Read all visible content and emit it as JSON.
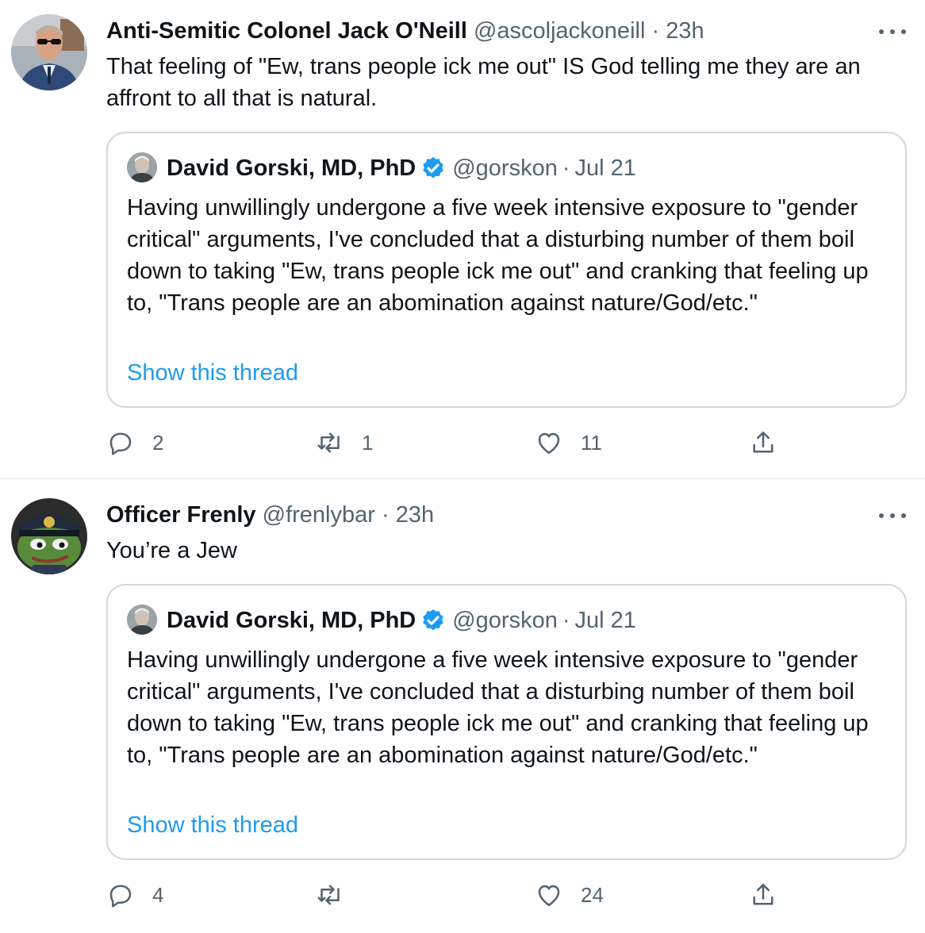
{
  "tweets": [
    {
      "display_name": "Anti-Semitic Colonel Jack O'Neill",
      "handle": "@ascoljackoneill",
      "separator": "·",
      "time": "23h",
      "text": "That feeling of \"Ew, trans people ick me out\" IS God telling me they are an affront to all that is natural.",
      "avatar_icon": "uniformed-man-sunglasses-avatar",
      "quote": {
        "display_name": "David Gorski, MD, PhD",
        "handle": "@gorskon",
        "separator": "·",
        "date": "Jul 21",
        "verified": true,
        "text": "Having unwillingly undergone a five week intensive exposure to \"gender critical\" arguments, I've concluded that a disturbing number of them boil down to taking \"Ew, trans people ick me out\" and cranking that feeling up to, \"Trans people are an abomination against nature/God/etc.\"",
        "link": "Show this thread"
      },
      "stats": {
        "replies": "2",
        "retweets": "1",
        "likes": "11"
      }
    },
    {
      "display_name": "Officer Frenly",
      "handle": "@frenlybar",
      "separator": "·",
      "time": "23h",
      "text": "You’re a Jew",
      "avatar_icon": "frog-police-cap-avatar",
      "quote": {
        "display_name": "David Gorski, MD, PhD",
        "handle": "@gorskon",
        "separator": "·",
        "date": "Jul 21",
        "verified": true,
        "text": "Having unwillingly undergone a five week intensive exposure to \"gender critical\" arguments, I've concluded that a disturbing number of them boil down to taking \"Ew, trans people ick me out\" and cranking that feeling up to, \"Trans people are an abomination against nature/God/etc.\"",
        "link": "Show this thread"
      },
      "stats": {
        "replies": "4",
        "retweets": "",
        "likes": "24"
      }
    }
  ],
  "colors": {
    "text": "#0f1419",
    "muted": "#536471",
    "link": "#1d9bf0",
    "verified": "#1d9bf0",
    "border": "#cfd9de"
  }
}
